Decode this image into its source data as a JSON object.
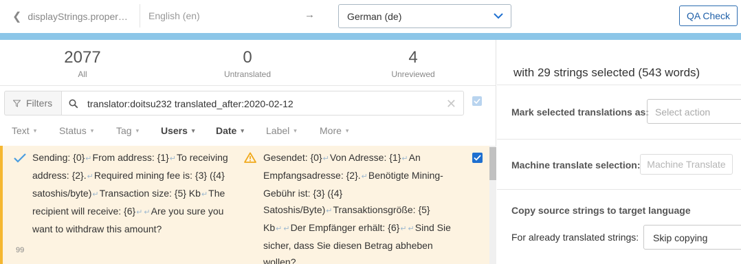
{
  "header": {
    "back_label": "displayStrings.proper…",
    "source_language": "English (en)",
    "arrow": "→",
    "target_language": "German (de)",
    "qa_check_label": "QA Check"
  },
  "stats": [
    {
      "count": "2077",
      "label": "All"
    },
    {
      "count": "0",
      "label": "Untranslated"
    },
    {
      "count": "4",
      "label": "Unreviewed"
    }
  ],
  "filters": {
    "button_label": "Filters",
    "query": "translator:doitsu232 translated_after:2020-02-12"
  },
  "facets": [
    {
      "label": "Text",
      "active": false
    },
    {
      "label": "Status",
      "active": false
    },
    {
      "label": "Tag",
      "active": false
    },
    {
      "label": "Users",
      "active": true
    },
    {
      "label": "Date",
      "active": true
    },
    {
      "label": "Label",
      "active": false
    },
    {
      "label": "More",
      "active": false
    }
  ],
  "row": {
    "number": "99",
    "source_parts": [
      "Sending: {0}",
      "From address: {1}",
      "To receiving address: {2}.",
      "Required mining fee is: {3} ({4} satoshis/byte)",
      "Transaction size: {5} Kb",
      "The recipient will receive: {6}",
      "",
      "Are you sure you want to withdraw this amount?"
    ],
    "target_parts": [
      "Gesendet: {0}",
      "Von Adresse: {1}",
      "An Empfangsadresse: {2}.",
      "Benötigte Mining-Gebühr ist: {3} ({4} Satoshis/Byte)",
      "Transaktionsgröße: {5} Kb",
      "",
      "Der Empfänger erhält: {6}",
      "",
      "Sind Sie sicher, dass Sie diesen Betrag abheben wollen?"
    ],
    "selected": true
  },
  "panel": {
    "selection_title": "with 29 strings selected (543 words)",
    "mark_label": "Mark selected translations as:",
    "mark_placeholder": "Select action",
    "machine_label": "Machine translate selection:",
    "machine_button": "Machine Translate",
    "copy_heading": "Copy source strings to target language",
    "copy_label": "For already translated strings:",
    "copy_value": "Skip copying"
  },
  "colors": {
    "accent_blue": "#1e6fd0",
    "row_highlight": "#fdf3e1",
    "row_border": "#f5b731",
    "top_strip": "#8cc6e8",
    "check_green_blue": "#4a9de0",
    "warning": "#f0a91c"
  },
  "icons": {
    "back": "chevron-left-icon",
    "target_dropdown": "chevron-down-icon",
    "filter": "funnel-icon",
    "search": "search-icon",
    "clear": "close-icon",
    "approved": "checkmark-icon",
    "warning": "warning-icon",
    "newline": "return-icon"
  }
}
